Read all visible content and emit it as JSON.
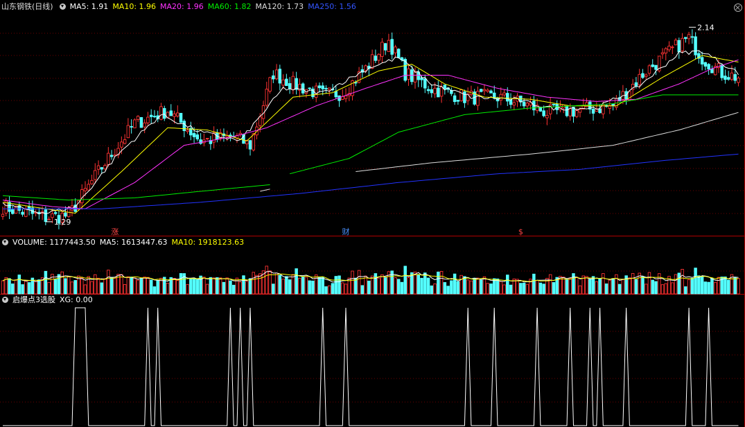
{
  "header": {
    "title": "山东钢铁(日线)",
    "ma5": "MA5: 1.91",
    "ma10": "MA10: 1.96",
    "ma20": "MA20: 1.96",
    "ma60": "MA60: 1.82",
    "ma120": "MA120: 1.73",
    "ma250": "MA250: 1.56"
  },
  "volume_header": {
    "volume": "VOLUME: 1177443.50",
    "ma5": "MA5: 1613447.63",
    "ma10": "MA10: 1918123.63"
  },
  "indicator_header": {
    "name": "启爆点3选股",
    "xg": "XG: 0.00"
  },
  "colors": {
    "up": "#ff3333",
    "down": "#54ffff",
    "ma5": "#ffffff",
    "ma10": "#ffff00",
    "ma20": "#ff33ff",
    "ma60": "#00ee00",
    "ma120": "#dddddd",
    "ma250": "#2233ff",
    "grid": "#6e0000"
  },
  "chart_data": [
    {
      "type": "candlestick",
      "panel": "price",
      "ylim": [
        1.22,
        2.22
      ],
      "annotations": [
        {
          "text": "1.29",
          "kind": "low",
          "index": 13,
          "value": 1.29
        },
        {
          "text": "2.14",
          "kind": "high",
          "index": 208,
          "value": 2.14
        }
      ],
      "event_marks": [
        {
          "text": "涨",
          "index": 34
        },
        {
          "text": "财",
          "index": 104
        },
        {
          "text": "$",
          "index": 157
        }
      ],
      "key_points": [
        [
          0,
          1.34
        ],
        [
          13,
          1.29
        ],
        [
          20,
          1.3
        ],
        [
          30,
          1.52
        ],
        [
          40,
          1.72
        ],
        [
          50,
          1.78
        ],
        [
          60,
          1.64
        ],
        [
          70,
          1.66
        ],
        [
          75,
          1.62
        ],
        [
          82,
          1.95
        ],
        [
          88,
          1.9
        ],
        [
          97,
          1.85
        ],
        [
          103,
          1.86
        ],
        [
          110,
          1.97
        ],
        [
          117,
          2.1
        ],
        [
          122,
          1.95
        ],
        [
          130,
          1.88
        ],
        [
          140,
          1.84
        ],
        [
          150,
          1.84
        ],
        [
          158,
          1.81
        ],
        [
          165,
          1.77
        ],
        [
          175,
          1.78
        ],
        [
          185,
          1.8
        ],
        [
          195,
          1.96
        ],
        [
          205,
          2.08
        ],
        [
          208,
          2.11
        ],
        [
          212,
          2.02
        ],
        [
          218,
          1.95
        ],
        [
          223,
          1.93
        ]
      ],
      "series": [
        {
          "name": "MA5",
          "key_points": [
            [
              0,
              1.35
            ],
            [
              13,
              1.31
            ],
            [
              22,
              1.34
            ],
            [
              35,
              1.58
            ],
            [
              48,
              1.76
            ],
            [
              60,
              1.68
            ],
            [
              72,
              1.64
            ],
            [
              85,
              1.88
            ],
            [
              97,
              1.86
            ],
            [
              112,
              1.98
            ],
            [
              120,
              2.02
            ],
            [
              130,
              1.9
            ],
            [
              142,
              1.84
            ],
            [
              155,
              1.83
            ],
            [
              166,
              1.79
            ],
            [
              180,
              1.79
            ],
            [
              192,
              1.88
            ],
            [
              205,
              2.04
            ],
            [
              212,
              2.05
            ],
            [
              223,
              1.95
            ]
          ]
        },
        {
          "name": "MA10",
          "key_points": [
            [
              0,
              1.36
            ],
            [
              13,
              1.33
            ],
            [
              22,
              1.31
            ],
            [
              36,
              1.5
            ],
            [
              50,
              1.7
            ],
            [
              62,
              1.69
            ],
            [
              74,
              1.64
            ],
            [
              88,
              1.84
            ],
            [
              100,
              1.86
            ],
            [
              114,
              1.96
            ],
            [
              124,
              1.99
            ],
            [
              134,
              1.9
            ],
            [
              146,
              1.84
            ],
            [
              160,
              1.83
            ],
            [
              172,
              1.8
            ],
            [
              186,
              1.8
            ],
            [
              200,
              1.93
            ],
            [
              212,
              2.03
            ],
            [
              223,
              2.0
            ]
          ]
        },
        {
          "name": "MA20",
          "key_points": [
            [
              0,
              1.37
            ],
            [
              15,
              1.34
            ],
            [
              25,
              1.33
            ],
            [
              40,
              1.45
            ],
            [
              55,
              1.62
            ],
            [
              70,
              1.66
            ],
            [
              80,
              1.7
            ],
            [
              95,
              1.8
            ],
            [
              110,
              1.88
            ],
            [
              122,
              1.94
            ],
            [
              135,
              1.94
            ],
            [
              150,
              1.88
            ],
            [
              165,
              1.84
            ],
            [
              180,
              1.82
            ],
            [
              192,
              1.83
            ],
            [
              205,
              1.9
            ],
            [
              215,
              1.97
            ],
            [
              223,
              2.01
            ]
          ]
        },
        {
          "name": "MA60",
          "segments": [
            [
              [
                0,
                1.39
              ],
              [
                20,
                1.37
              ],
              [
                40,
                1.38
              ],
              [
                60,
                1.41
              ],
              [
                81,
                1.44
              ]
            ],
            [
              [
                87,
                1.49
              ],
              [
                105,
                1.56
              ],
              [
                120,
                1.68
              ],
              [
                140,
                1.76
              ],
              [
                160,
                1.79
              ],
              [
                185,
                1.81
              ],
              [
                200,
                1.85
              ],
              [
                223,
                1.85
              ]
            ]
          ]
        },
        {
          "name": "MA120",
          "segments": [
            [
              [
                78,
                1.41
              ],
              [
                81,
                1.42
              ]
            ],
            [
              [
                107,
                1.5
              ],
              [
                130,
                1.54
              ],
              [
                160,
                1.58
              ],
              [
                185,
                1.62
              ],
              [
                205,
                1.69
              ],
              [
                223,
                1.77
              ]
            ]
          ]
        },
        {
          "name": "MA250",
          "key_points": [
            [
              0,
              1.33
            ],
            [
              30,
              1.33
            ],
            [
              60,
              1.36
            ],
            [
              90,
              1.4
            ],
            [
              120,
              1.45
            ],
            [
              150,
              1.49
            ],
            [
              175,
              1.51
            ],
            [
              200,
              1.55
            ],
            [
              223,
              1.58
            ]
          ]
        }
      ]
    },
    {
      "type": "bar",
      "panel": "volume",
      "ylim": [
        0,
        4200000
      ],
      "series": [
        {
          "name": "MA5"
        },
        {
          "name": "MA10"
        }
      ]
    },
    {
      "type": "line",
      "panel": "indicator",
      "ylim": [
        0,
        1
      ],
      "values_description": "binary 0/1 signal",
      "pulses": [
        [
          22,
          25
        ],
        [
          44,
          44
        ],
        [
          47,
          47
        ],
        [
          69,
          69
        ],
        [
          72,
          72
        ],
        [
          75,
          75
        ],
        [
          97,
          97
        ],
        [
          104,
          104
        ],
        [
          141,
          141
        ],
        [
          149,
          149
        ],
        [
          162,
          162
        ],
        [
          172,
          172
        ],
        [
          178,
          178
        ],
        [
          181,
          181
        ],
        [
          189,
          189
        ],
        [
          208,
          208
        ],
        [
          214,
          214
        ]
      ]
    }
  ]
}
